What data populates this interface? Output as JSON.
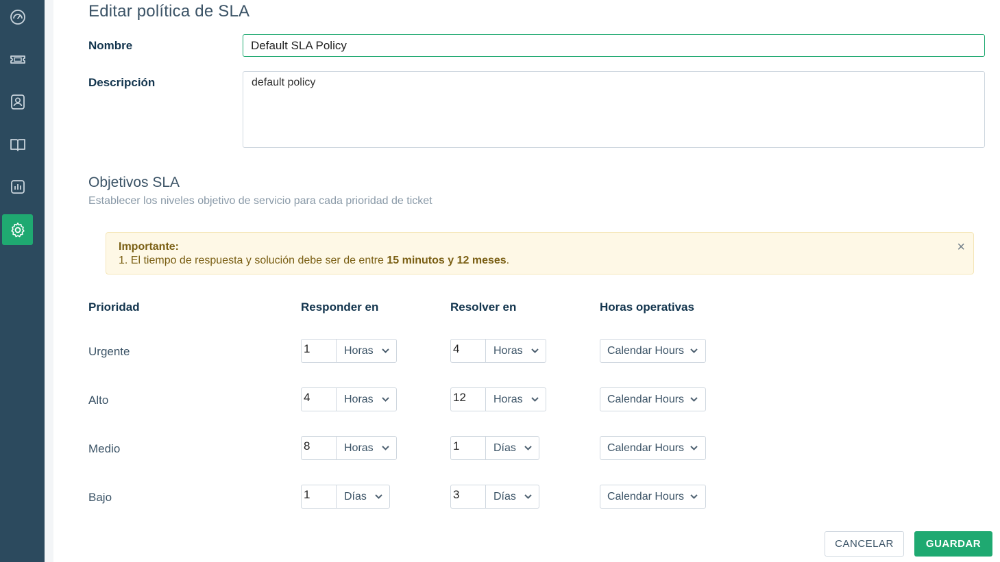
{
  "sidebar": {
    "items": [
      {
        "icon": "dashboard-icon",
        "active": false
      },
      {
        "icon": "ticket-icon",
        "active": false
      },
      {
        "icon": "contacts-icon",
        "active": false
      },
      {
        "icon": "knowledge-base-icon",
        "active": false
      },
      {
        "icon": "reports-icon",
        "active": false
      },
      {
        "icon": "settings-icon",
        "active": true
      }
    ]
  },
  "page": {
    "title": "Editar política de SLA"
  },
  "form": {
    "name_label": "Nombre",
    "name_value": "Default SLA Policy",
    "description_label": "Descripción",
    "description_value": "default policy"
  },
  "targets": {
    "title": "Objetivos SLA",
    "subtitle": "Establecer los niveles objetivo de servicio para cada prioridad de ticket"
  },
  "alert": {
    "title": "Importante:",
    "text_prefix": "1. El tiempo de respuesta y solución debe ser de entre ",
    "text_bold": "15 minutos y 12 meses",
    "text_suffix": ".",
    "close": "×"
  },
  "table": {
    "headers": {
      "priority": "Prioridad",
      "respond": "Responder en",
      "resolve": "Resolver en",
      "hours": "Horas operativas"
    },
    "rows": [
      {
        "priority": "Urgente",
        "respond_value": "1",
        "respond_unit": "Horas",
        "resolve_value": "4",
        "resolve_unit": "Horas",
        "hours": "Calendar Hours"
      },
      {
        "priority": "Alto",
        "respond_value": "4",
        "respond_unit": "Horas",
        "resolve_value": "12",
        "resolve_unit": "Horas",
        "hours": "Calendar Hours"
      },
      {
        "priority": "Medio",
        "respond_value": "8",
        "respond_unit": "Horas",
        "resolve_value": "1",
        "resolve_unit": "Días",
        "hours": "Calendar Hours"
      },
      {
        "priority": "Bajo",
        "respond_value": "1",
        "respond_unit": "Días",
        "resolve_value": "3",
        "resolve_unit": "Días",
        "hours": "Calendar Hours"
      }
    ]
  },
  "buttons": {
    "cancel": "CANCELAR",
    "save": "GUARDAR"
  },
  "colors": {
    "accent": "#1fa971",
    "sidebar": "#2c4a5e",
    "alert_bg": "#fef8e6"
  }
}
